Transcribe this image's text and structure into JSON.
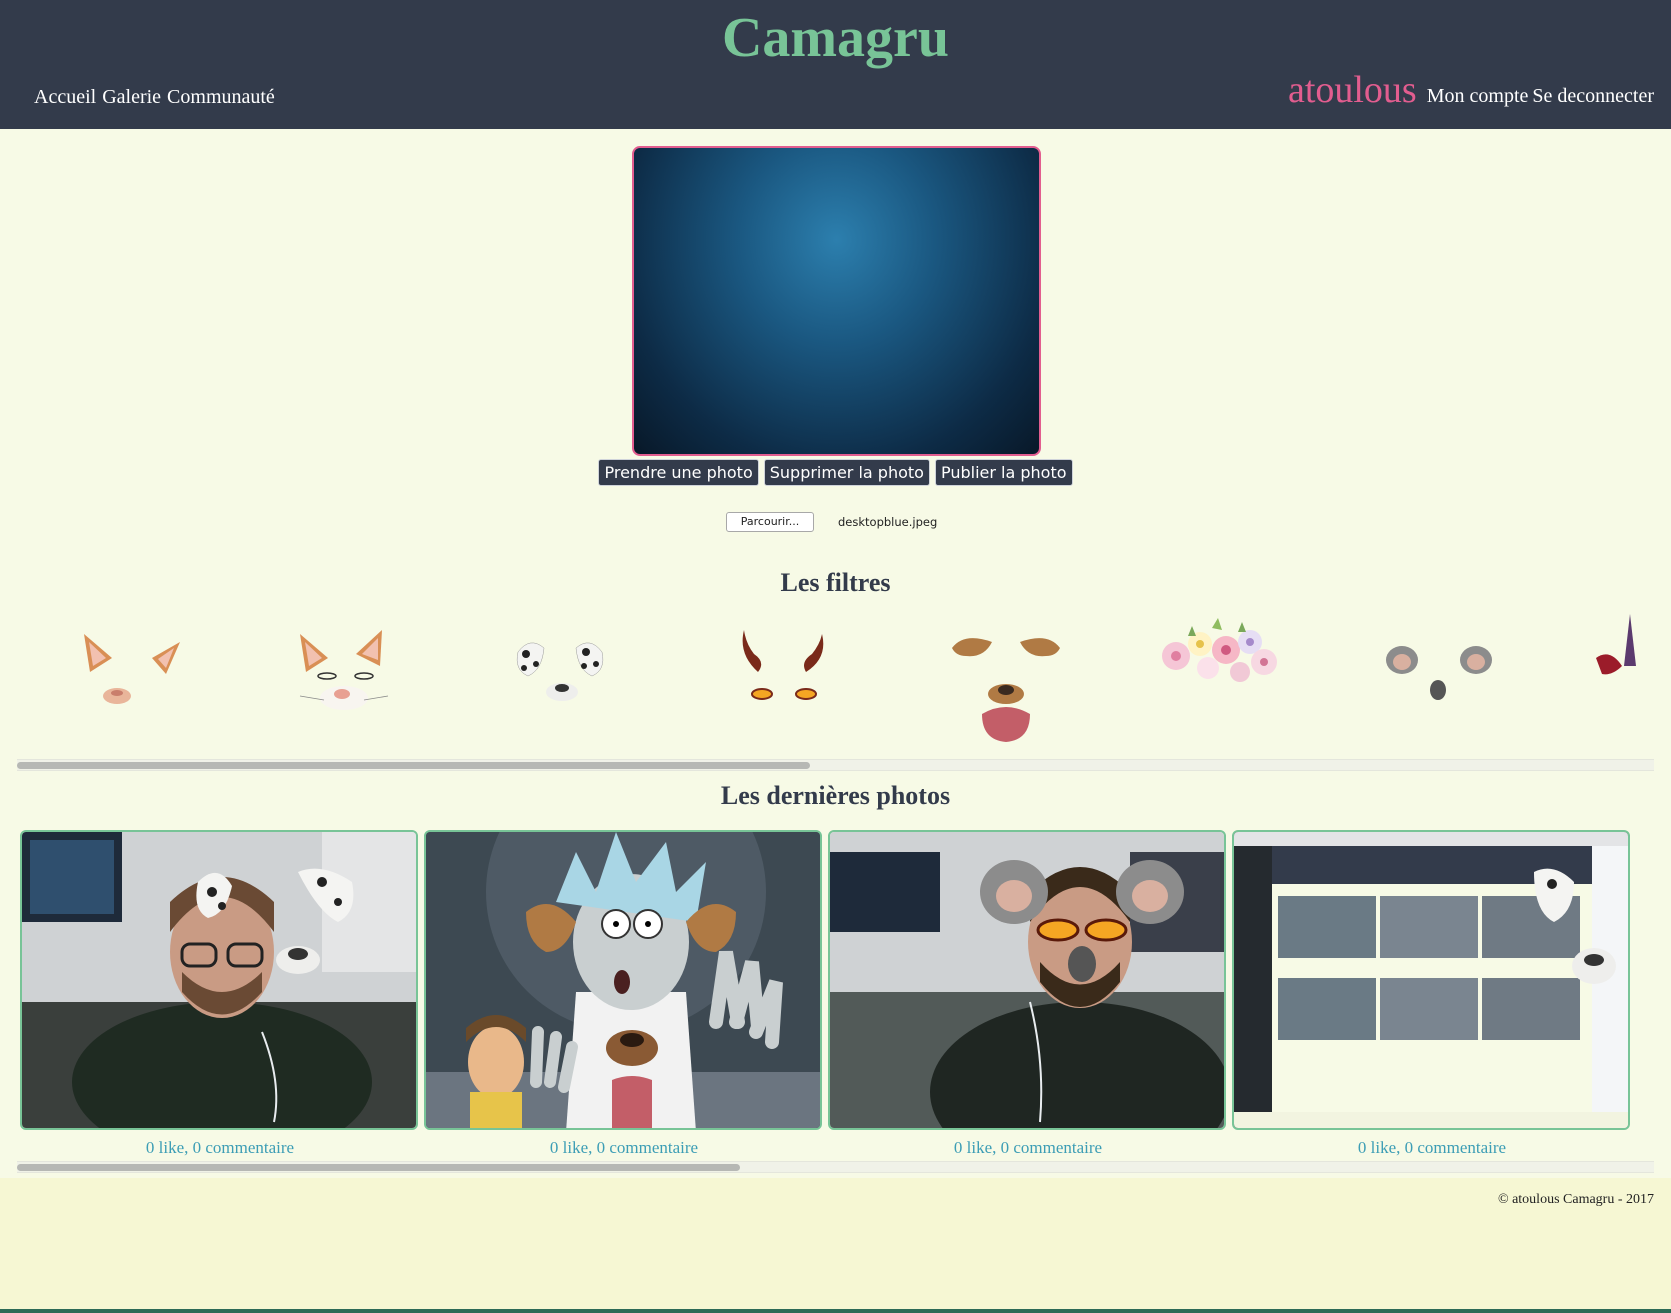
{
  "header": {
    "logo": "Camagru",
    "nav": [
      "Accueil",
      "Galerie",
      "Communauté"
    ],
    "username": "atoulous",
    "account_link": "Mon compte",
    "logout_link": "Se deconnecter"
  },
  "camera": {
    "buttons": {
      "take": "Prendre une photo",
      "delete": "Supprimer la photo",
      "publish": "Publier la photo"
    },
    "file_button": "Parcourir...",
    "file_name": "desktopblue.jpeg"
  },
  "filters": {
    "title": "Les filtres",
    "items": [
      "cat-ears-filter",
      "white-cat-filter",
      "dalmatian-filter",
      "devil-filter",
      "dog-filter",
      "flower-crown-filter",
      "koala-filter",
      "unicorn-filter"
    ]
  },
  "photos": {
    "title": "Les dernières photos",
    "items": [
      {
        "caption": "0 like, 0 commentaire"
      },
      {
        "caption": "0 like, 0 commentaire"
      },
      {
        "caption": "0 like, 0 commentaire"
      },
      {
        "caption": "0 like, 0 commentaire"
      }
    ]
  },
  "footer": {
    "text": "© atoulous Camagru - 2017"
  },
  "colors": {
    "header_bg": "#333b4b",
    "logo": "#78c497",
    "username": "#e25d8f",
    "page_bg": "#f7fae6",
    "caption": "#3c9db5"
  }
}
